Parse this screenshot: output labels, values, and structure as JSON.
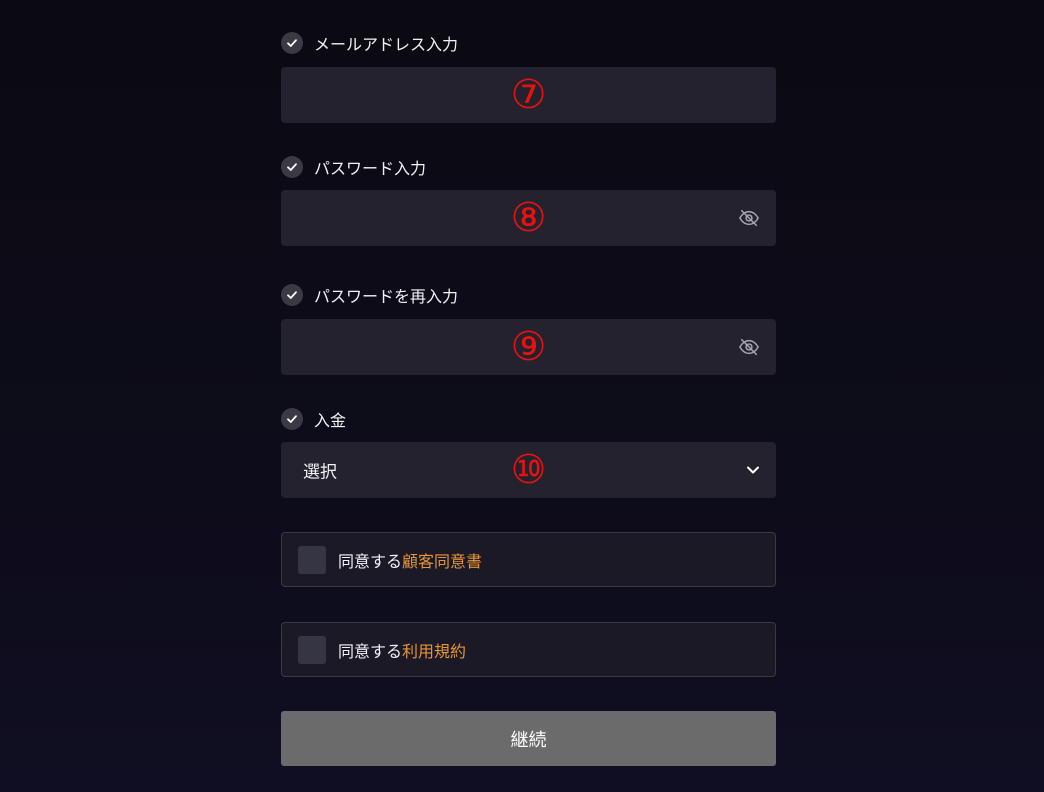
{
  "fields": {
    "email": {
      "label": "メールアドレス入力",
      "value": "",
      "marker": "⑦"
    },
    "password": {
      "label": "パスワード入力",
      "value": "",
      "marker": "⑧"
    },
    "password_confirm": {
      "label": "パスワードを再入力",
      "value": "",
      "marker": "⑨"
    },
    "deposit": {
      "label": "入金",
      "selected": "選択",
      "marker": "⑩"
    }
  },
  "agreements": [
    {
      "prefix": "同意する",
      "link": "顧客同意書",
      "checked": false
    },
    {
      "prefix": "同意する",
      "link": "利用規約",
      "checked": false
    }
  ],
  "continue_label": "継続",
  "colors": {
    "background": "#0d0c1a",
    "input_bg": "#23222e",
    "link_accent": "#e89536",
    "marker_red": "#e8120f",
    "button_bg": "#6c6b6c"
  },
  "icons": {
    "field_status": "check-icon",
    "password_toggle": "eye-off-icon",
    "dropdown": "chevron-down-icon"
  }
}
